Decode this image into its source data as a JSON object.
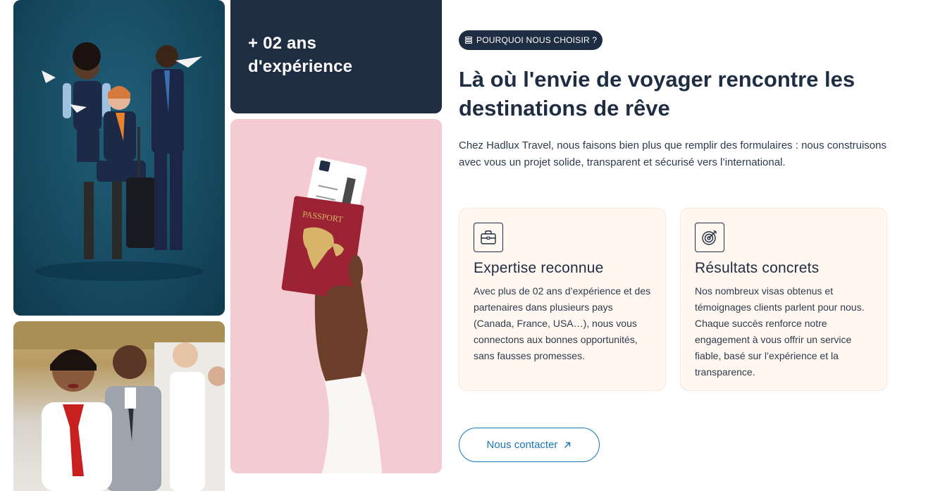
{
  "experience": {
    "text": "+ 02 ans d'expérience"
  },
  "badge": {
    "label": "POURQUOI NOUS CHOISIR ?",
    "icon": "stack-icon"
  },
  "headline": "Là où l'envie de voyager rencontre les destinations de rêve",
  "intro": "Chez Hadlux Travel, nous faisons bien plus que remplir des formulaires : nous construisons avec vous un projet solide, transparent et sécurisé vers l’international.",
  "features": [
    {
      "icon": "briefcase-icon",
      "title": "Expertise reconnue",
      "description": "Avec plus de 02 ans d’expérience et des partenaires dans plusieurs pays (Canada, France, USA…), nous vous connectons aux bonnes opportunités, sans fausses promesses."
    },
    {
      "icon": "target-icon",
      "title": "Résultats concrets",
      "description": "Nos nombreux visas obtenus et témoignages clients parlent pour nous. Chaque succès renforce notre engagement à vous offrir un service fiable, basé sur l’expérience et la transparence."
    }
  ],
  "contact_button": {
    "label": "Nous contacter",
    "icon": "arrow-up-right-icon"
  },
  "passport_photo": {
    "passport_label": "PASSPORT"
  },
  "colors": {
    "navy": "#1f2d43",
    "accent_blue": "#1877b6",
    "card_bg": "#fff7f0",
    "pink": "#f5cbd3",
    "teal": "#174b62"
  }
}
